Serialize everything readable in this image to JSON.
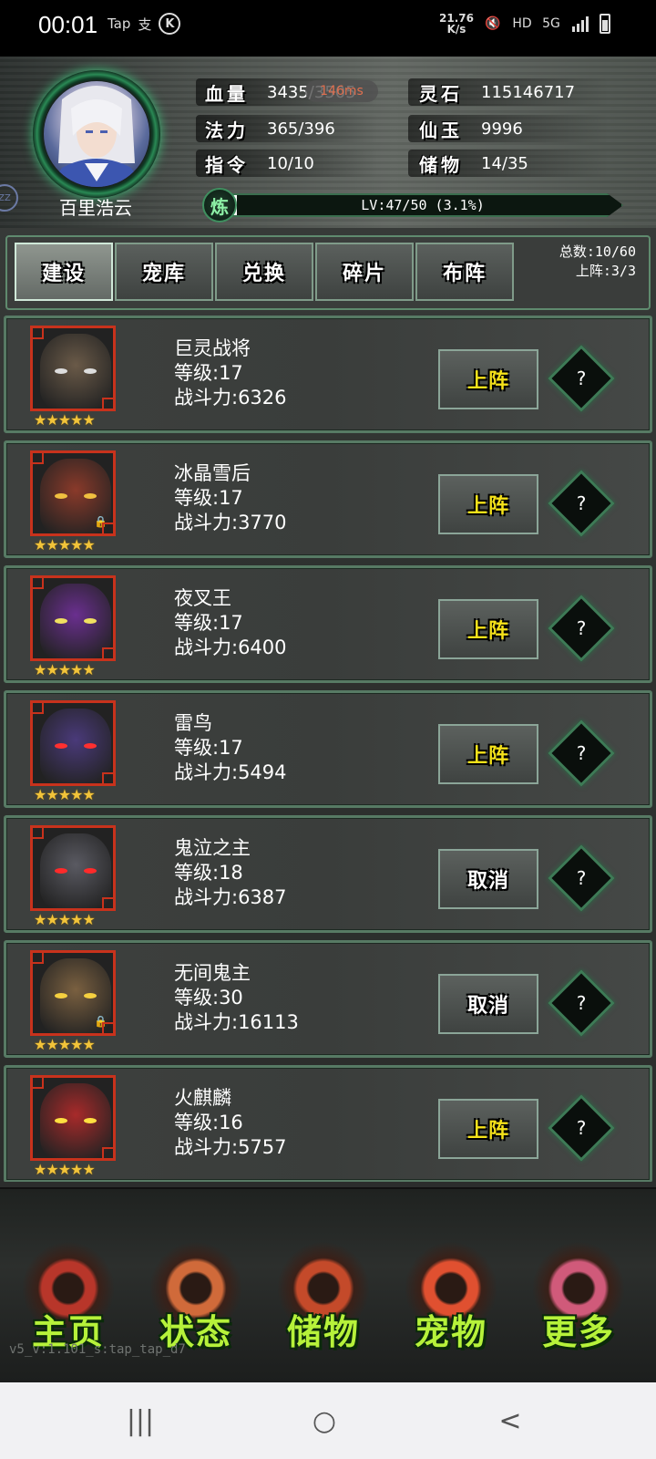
{
  "status_bar": {
    "time": "00:01",
    "apps": [
      "Tap",
      "支",
      "K"
    ],
    "net_speed_value": "21.76",
    "net_speed_unit": "K/s",
    "hd": "HD",
    "network": "5G"
  },
  "player": {
    "name": "百里浩云",
    "ping": "146ms",
    "stats": {
      "hp_label": "血量",
      "hp_value": "3435/3505",
      "mp_label": "法力",
      "mp_value": "365/396",
      "cmd_label": "指令",
      "cmd_value": "10/10",
      "stone_label": "灵石",
      "stone_value": "115146717",
      "jade_label": "仙玉",
      "jade_value": "9996",
      "storage_label": "储物",
      "storage_value": "14/35"
    },
    "level": {
      "icon_label": "炼",
      "text": "LV:47/50 (3.1%)",
      "progress_percent": 3.1
    }
  },
  "tabs": [
    {
      "label": "建设",
      "active": true
    },
    {
      "label": "宠库",
      "active": false
    },
    {
      "label": "兑换",
      "active": false
    },
    {
      "label": "碎片",
      "active": false
    },
    {
      "label": "布阵",
      "active": false
    }
  ],
  "counts": {
    "total": "总数:10/60",
    "deployed": "上阵:3/3"
  },
  "pets": [
    {
      "name": "巨灵战将",
      "level": "等级:17",
      "power": "战斗力:6326",
      "action": "上阵",
      "stars": "★★★★★",
      "help": "?",
      "locked": false,
      "color": "#6a5a48",
      "eye": "#ddd"
    },
    {
      "name": "冰晶雪后",
      "level": "等级:17",
      "power": "战斗力:3770",
      "action": "上阵",
      "stars": "★★★★★",
      "help": "?",
      "locked": true,
      "color": "#8a3a2a",
      "eye": "#f0c040"
    },
    {
      "name": "夜叉王",
      "level": "等级:17",
      "power": "战斗力:6400",
      "action": "上阵",
      "stars": "★★★★★",
      "help": "?",
      "locked": false,
      "color": "#6a2f8f",
      "eye": "#f0e060"
    },
    {
      "name": "雷鸟",
      "level": "等级:17",
      "power": "战斗力:5494",
      "action": "上阵",
      "stars": "★★★★★",
      "help": "?",
      "locked": false,
      "color": "#4a3a7a",
      "eye": "#ff3030"
    },
    {
      "name": "鬼泣之主",
      "level": "等级:18",
      "power": "战斗力:6387",
      "action": "取消",
      "stars": "★★★★★",
      "help": "?",
      "locked": false,
      "color": "#5a5a62",
      "eye": "#ff2a2a"
    },
    {
      "name": "无间鬼主",
      "level": "等级:30",
      "power": "战斗力:16113",
      "action": "取消",
      "stars": "★★★★★",
      "help": "?",
      "locked": true,
      "color": "#7a6040",
      "eye": "#f5d040"
    },
    {
      "name": "火麒麟",
      "level": "等级:16",
      "power": "战斗力:5757",
      "action": "上阵",
      "stars": "★★★★★",
      "help": "?",
      "locked": false,
      "color": "#a82a2a",
      "eye": "#ffe040"
    }
  ],
  "bottom_nav": [
    {
      "label": "主页",
      "icon": "home-emblem-icon",
      "color": "#b8362a"
    },
    {
      "label": "状态",
      "icon": "status-emblem-icon",
      "color": "#d06a3a"
    },
    {
      "label": "储物",
      "icon": "storage-emblem-icon",
      "color": "#c44a2a"
    },
    {
      "label": "宠物",
      "icon": "pet-phoenix-icon",
      "color": "#e05030"
    },
    {
      "label": "更多",
      "icon": "more-emblem-icon",
      "color": "#d05a7a"
    }
  ],
  "version": "v5_v:1.101_s:tap_tap_d7",
  "android_nav": {
    "recent": "|||",
    "home": "○",
    "back": "<"
  }
}
